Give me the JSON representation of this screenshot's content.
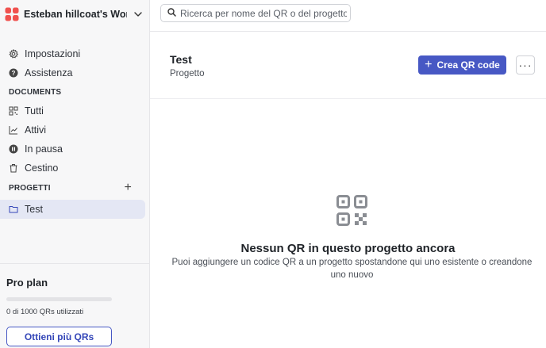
{
  "workspace": {
    "name": "Esteban hillcoat's Work..."
  },
  "sidebar": {
    "items": [
      {
        "label": "Impostazioni"
      },
      {
        "label": "Assistenza"
      }
    ],
    "documents_label": "DOCUMENTS",
    "documents": [
      {
        "label": "Tutti"
      },
      {
        "label": "Attivi"
      },
      {
        "label": "In pausa"
      },
      {
        "label": "Cestino"
      }
    ],
    "projects_label": "PROGETTI",
    "projects": [
      {
        "label": "Test"
      }
    ]
  },
  "plan": {
    "title": "Pro plan",
    "used": 0,
    "limit": 1000,
    "usage_text": "0 di 1000 QRs utilizzati",
    "cta_label": "Ottieni più QRs",
    "accent": "#4758c4"
  },
  "search": {
    "placeholder": "Ricerca per nome del QR o del progetto",
    "value": ""
  },
  "project": {
    "title": "Test",
    "subtitle": "Progetto",
    "create_label": "Crea QR code",
    "more_label": "···"
  },
  "empty_state": {
    "icon": "qr-code-icon",
    "title": "Nessun QR in questo progetto ancora",
    "description": "Puoi aggiungere un codice QR a un progetto spostandone qui uno esistente o creandone uno nuovo"
  },
  "colors": {
    "primary": "#4758c4",
    "active_bg": "#e4e7f4",
    "logo": "#f0524f"
  }
}
